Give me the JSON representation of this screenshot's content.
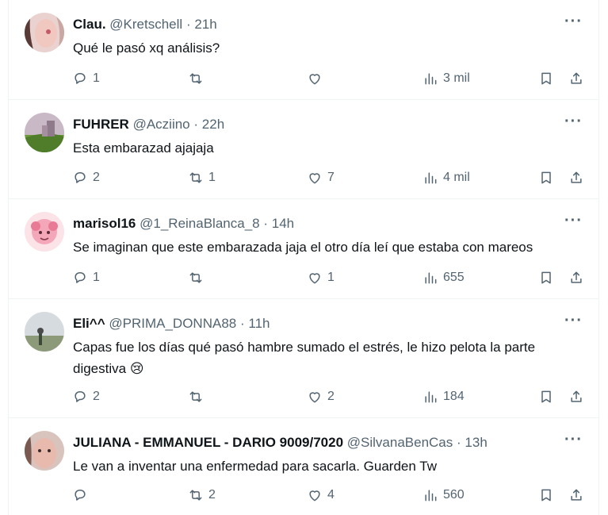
{
  "tweets": [
    {
      "name": "Clau.",
      "handle": "@Kretschell",
      "time": "21h",
      "text": "Qué le pasó xq análisis?",
      "replies": "1",
      "retweets": "",
      "likes": "",
      "views": "3 mil"
    },
    {
      "name": "FUHRER",
      "handle": "@Acziino",
      "time": "22h",
      "text": "Esta embarazad ajajaja",
      "replies": "2",
      "retweets": "1",
      "likes": "7",
      "views": "4 mil"
    },
    {
      "name": "marisol16",
      "handle": "@1_ReinaBlanca_8",
      "time": "14h",
      "text": "Se imaginan que este embarazada jaja el otro día leí que estaba con mareos",
      "replies": "1",
      "retweets": "",
      "likes": "1",
      "views": "655"
    },
    {
      "name": "Eli^^",
      "handle": "@PRIMA_DONNA88",
      "time": "11h",
      "text": "Capas fue los días qué pasó hambre sumado el estrés, le hizo pelota la parte digestiva 😢",
      "replies": "2",
      "retweets": "",
      "likes": "2",
      "views": "184"
    },
    {
      "name": "JULIANA - EMMANUEL - DARIO 9009/7020",
      "handle": "@SilvanaBenCas",
      "time": "13h",
      "text": "Le van a inventar una enfermedad para sacarla. Guarden Tw",
      "replies": "",
      "retweets": "2",
      "likes": "4",
      "views": "560"
    }
  ],
  "separator": "·",
  "more_label": "···",
  "colors": {
    "text": "#0f1419",
    "muted": "#536471",
    "border": "#eff3f4"
  },
  "icons": {
    "reply": "reply-icon",
    "retweet": "retweet-icon",
    "like": "like-icon",
    "views": "views-icon",
    "bookmark": "bookmark-icon",
    "share": "share-icon"
  }
}
